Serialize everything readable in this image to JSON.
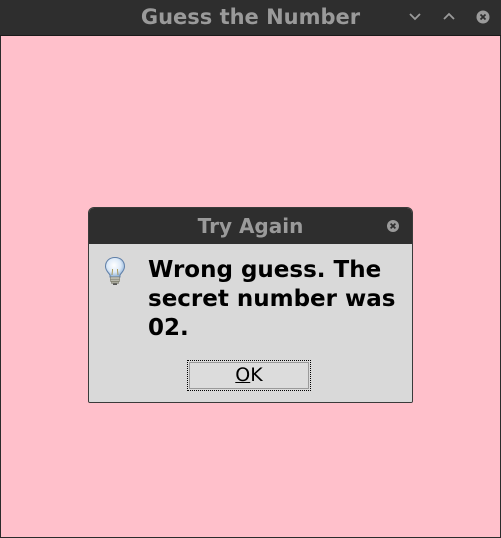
{
  "window": {
    "title": "Guess the Number",
    "controls": {
      "minimize_icon": "chevron-down-icon",
      "maximize_icon": "chevron-up-icon",
      "close_icon": "close-icon"
    },
    "background_color": "#ffc0cb"
  },
  "dialog": {
    "title": "Try Again",
    "icon": "lightbulb-icon",
    "message": "Wrong guess. The\nsecret number was\n02.",
    "ok_button": {
      "mnemonic": "O",
      "rest": "K"
    }
  }
}
